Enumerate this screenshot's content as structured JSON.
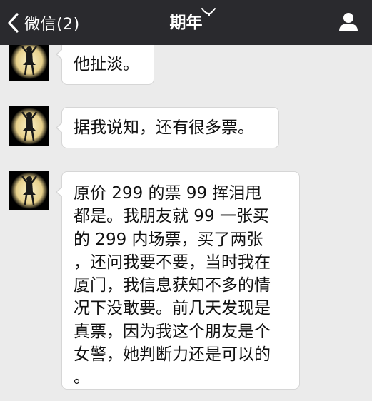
{
  "navbar": {
    "back_label": "微信(2)",
    "title": "期年",
    "back_icon": "chevron-left-icon",
    "mute_icon": "mute-icon",
    "contact_icon": "person-icon"
  },
  "messages": [
    {
      "sender": "other",
      "text": "他扯淡。"
    },
    {
      "sender": "other",
      "text": "据我说知，还有很多票。"
    },
    {
      "sender": "other",
      "text": "原价 299 的票 99 挥泪甩\n都是。我朋友就 99 一张买\n的 299 内场票，买了两张\n，还问我要不要，当时我在\n厦门，我信息获知不多的情\n况下没敢要。前几天发现是\n真票，因为我这个朋友是个\n女警，她判断力还是可以的\n。"
    }
  ],
  "colors": {
    "navbar_bg": "#2a2a2e",
    "chat_bg": "#ebebeb",
    "bubble_bg": "#ffffff",
    "avatar_glow": "#f1e2b0"
  }
}
